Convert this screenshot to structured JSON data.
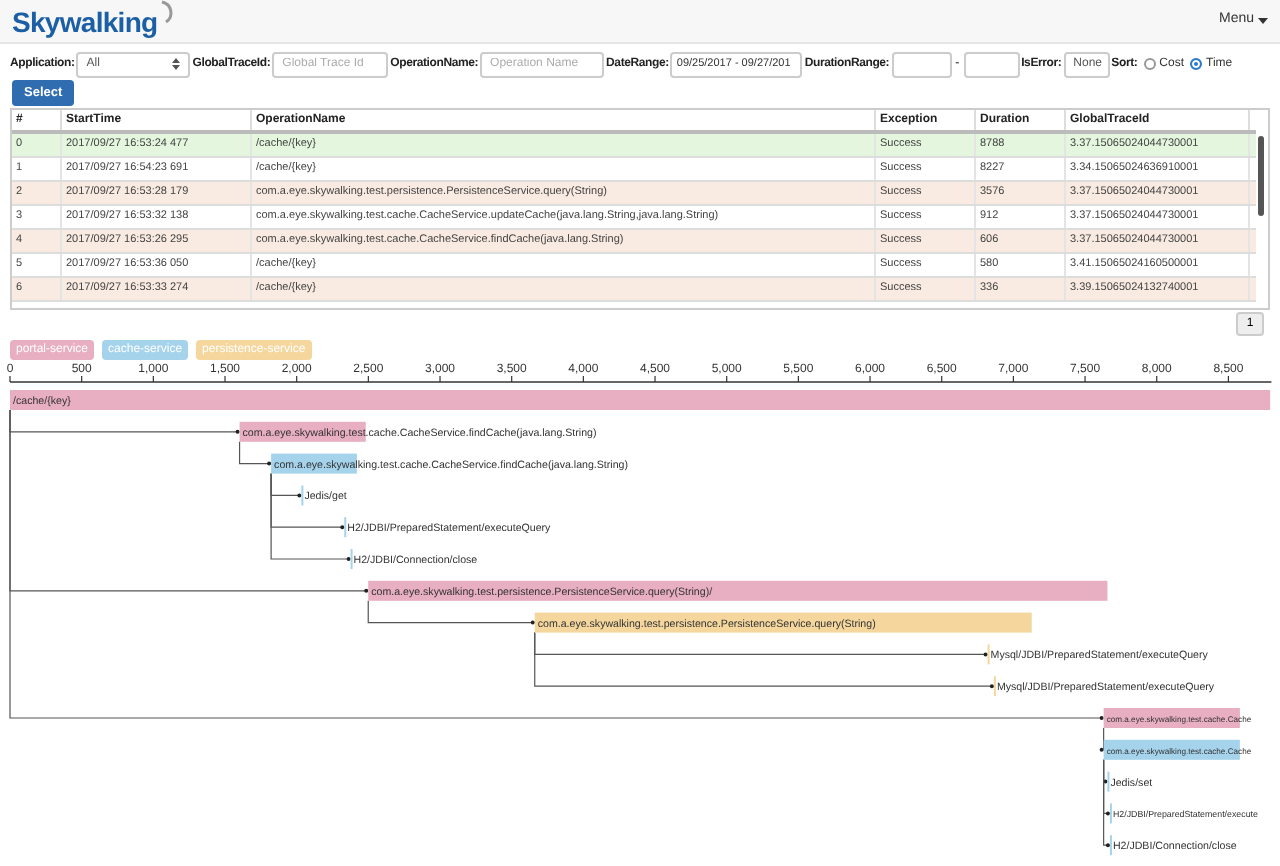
{
  "header": {
    "logo": "Skywalking",
    "menu": "Menu"
  },
  "filters": {
    "application": {
      "label": "Application:",
      "value": "All"
    },
    "global_trace_id": {
      "label": "GlobalTraceId:",
      "placeholder": "Global Trace Id"
    },
    "operation_name": {
      "label": "OperationName:",
      "placeholder": "Operation Name"
    },
    "date_range": {
      "label": "DateRange:",
      "value": "09/25/2017 - 09/27/201"
    },
    "duration_range": {
      "label": "DurationRange:",
      "separator": "-"
    },
    "is_error": {
      "label": "IsError:",
      "value": "None"
    },
    "sort": {
      "label": "Sort:",
      "options": [
        {
          "label": "Cost",
          "selected": false
        },
        {
          "label": "Time",
          "selected": true
        }
      ]
    },
    "select_button": "Select"
  },
  "table": {
    "columns": [
      "#",
      "StartTime",
      "OperationName",
      "Exception",
      "Duration",
      "GlobalTraceId"
    ],
    "rows": [
      {
        "cells": [
          "0",
          "2017/09/27 16:53:24 477",
          "/cache/{key}",
          "Success",
          "8788",
          "3.37.15065024044730001"
        ],
        "selected": true
      },
      {
        "cells": [
          "1",
          "2017/09/27 16:54:23 691",
          "/cache/{key}",
          "Success",
          "8227",
          "3.34.15065024636910001"
        ],
        "selected": false
      },
      {
        "cells": [
          "2",
          "2017/09/27 16:53:28 179",
          "com.a.eye.skywalking.test.persistence.PersistenceService.query(String)",
          "Success",
          "3576",
          "3.37.15065024044730001"
        ],
        "selected": false
      },
      {
        "cells": [
          "3",
          "2017/09/27 16:53:32 138",
          "com.a.eye.skywalking.test.cache.CacheService.updateCache(java.lang.String,java.lang.String)",
          "Success",
          "912",
          "3.37.15065024044730001"
        ],
        "selected": false
      },
      {
        "cells": [
          "4",
          "2017/09/27 16:53:26 295",
          "com.a.eye.skywalking.test.cache.CacheService.findCache(java.lang.String)",
          "Success",
          "606",
          "3.37.15065024044730001"
        ],
        "selected": false
      },
      {
        "cells": [
          "5",
          "2017/09/27 16:53:36 050",
          "/cache/{key}",
          "Success",
          "580",
          "3.41.15065024160500001"
        ],
        "selected": false
      },
      {
        "cells": [
          "6",
          "2017/09/27 16:53:33 274",
          "/cache/{key}",
          "Success",
          "336",
          "3.39.15065024132740001"
        ],
        "selected": false
      }
    ]
  },
  "pagination": {
    "pages": [
      {
        "label": "1",
        "selected": true
      }
    ]
  },
  "trace": {
    "services": [
      {
        "label": "portal-service",
        "color": "#e8aec2"
      },
      {
        "label": "cache-service",
        "color": "#a5d3ec"
      },
      {
        "label": "persistence-service",
        "color": "#f5d79e"
      }
    ],
    "axis_ticks": [
      "0",
      "500",
      "1,000",
      "1,500",
      "2,000",
      "2,500",
      "3,000",
      "3,500",
      "4,000",
      "4,500",
      "5,000",
      "5,500",
      "6,000",
      "6,500",
      "7,000",
      "7,500",
      "8,000",
      "8,500"
    ],
    "spans": [
      {
        "label": "/cache/{key}",
        "color": "#e8aec2",
        "children": [
          {
            "label": "com.a.eye.skywalking.test.cache.CacheService.findCache(java.lang.String)",
            "color": "#e8aec2",
            "children": [
              {
                "label": "com.a.eye.skywalking.test.cache.CacheService.findCache(java.lang.String)",
                "color": "#a5d3ec",
                "children": [
                  {
                    "label": "Jedis/get",
                    "color": "#a5d3ec"
                  },
                  {
                    "label": "H2/JDBI/PreparedStatement/executeQuery",
                    "color": "#a5d3ec"
                  },
                  {
                    "label": "H2/JDBI/Connection/close",
                    "color": "#a5d3ec"
                  }
                ]
              }
            ]
          },
          {
            "label": "com.a.eye.skywalking.test.persistence.PersistenceService.query(String)/",
            "color": "#e8aec2",
            "children": [
              {
                "label": "com.a.eye.skywalking.test.persistence.PersistenceService.query(String)",
                "color": "#f5d79e",
                "children": [
                  {
                    "label": "Mysql/JDBI/PreparedStatement/executeQuery",
                    "color": "#f5d79e"
                  },
                  {
                    "label": "Mysql/JDBI/PreparedStatement/executeQuery",
                    "color": "#f5d79e"
                  }
                ]
              }
            ]
          },
          {
            "label": "com.a.eye.skywalking.test.cache.Cache",
            "color": "#e8aec2",
            "children": [
              {
                "label": "com.a.eye.skywalking.test.cache.Cache",
                "color": "#a5d3ec",
                "children": [
                  {
                    "label": "Jedis/set",
                    "color": "#a5d3ec"
                  },
                  {
                    "label": "H2/JDBI/PreparedStatement/execute",
                    "color": "#a5d3ec"
                  },
                  {
                    "label": "H2/JDBI/Connection/close",
                    "color": "#a5d3ec"
                  }
                ]
              }
            ]
          }
        ]
      }
    ]
  }
}
